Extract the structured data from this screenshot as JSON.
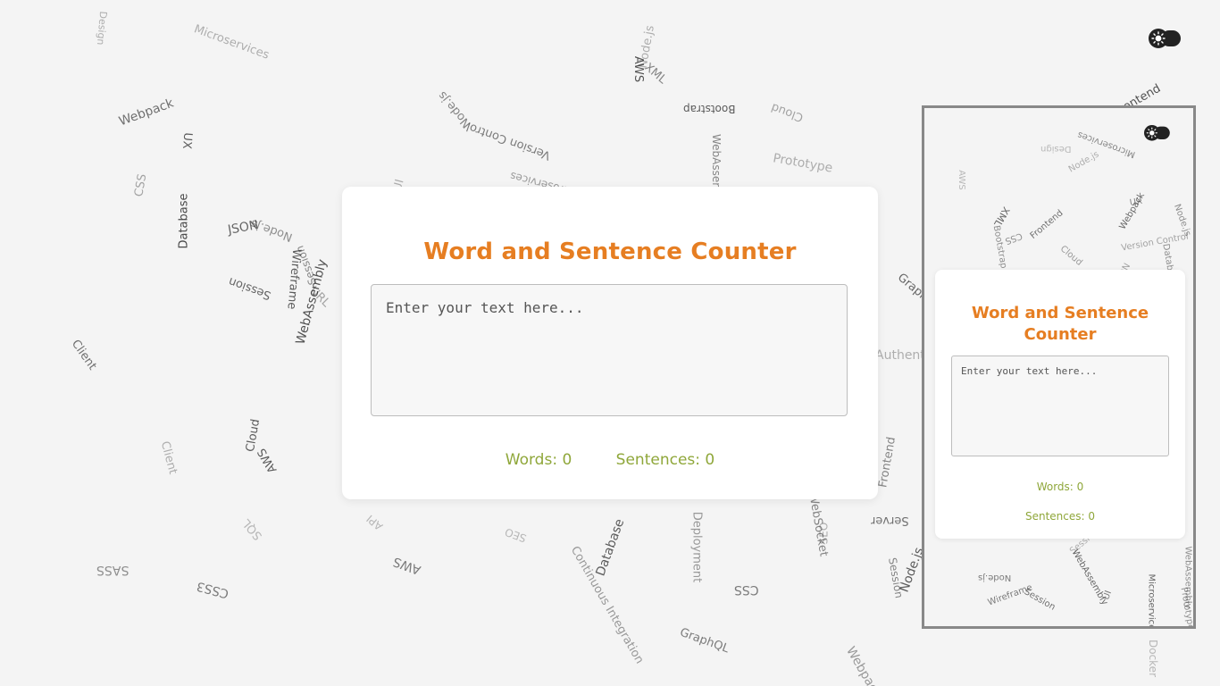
{
  "desktop": {
    "title": "Word and Sentence Counter",
    "textarea_placeholder": "Enter your text here...",
    "words_label": "Words: 0",
    "sentences_label": "Sentences: 0"
  },
  "mobile_preview": {
    "title_line1": "Word and Sentence",
    "title_line2": "Counter",
    "textarea_placeholder": "Enter your text here...",
    "words_label": "Words: 0",
    "sentences_label": "Sentences: 0"
  },
  "theme_toggle": {
    "icon": "sun-icon"
  },
  "colors": {
    "accent": "#e67e22",
    "stats": "#8fa73a",
    "background": "#f4f4f4"
  },
  "background_words": [
    "Design",
    "Microservices",
    "Node.js",
    "AWS",
    "XML",
    "Frontend",
    "Webpack",
    "UX",
    "Node.js",
    "Version Control",
    "Bootstrap",
    "Cloud",
    "CSS",
    "Database",
    "JSON",
    "Node.js",
    "Wireframe",
    "Session",
    "WebAssembly",
    "UI",
    "Microservices",
    "WebAssembly",
    "Prototype",
    "Session",
    "URL",
    "Client",
    "GraphQL",
    "Authentication",
    "Cloud",
    "AWS",
    "Client",
    "Frontend",
    "Server",
    "SQL",
    "API",
    "SASS",
    "CSS3",
    "AWS",
    "Continuous Integration",
    "Database",
    "SEO",
    "Deployment",
    "CSS",
    "WebSocket",
    "SEO",
    "Server",
    "Node.js",
    "Session",
    "GraphQL",
    "Webpack",
    "Docker"
  ]
}
